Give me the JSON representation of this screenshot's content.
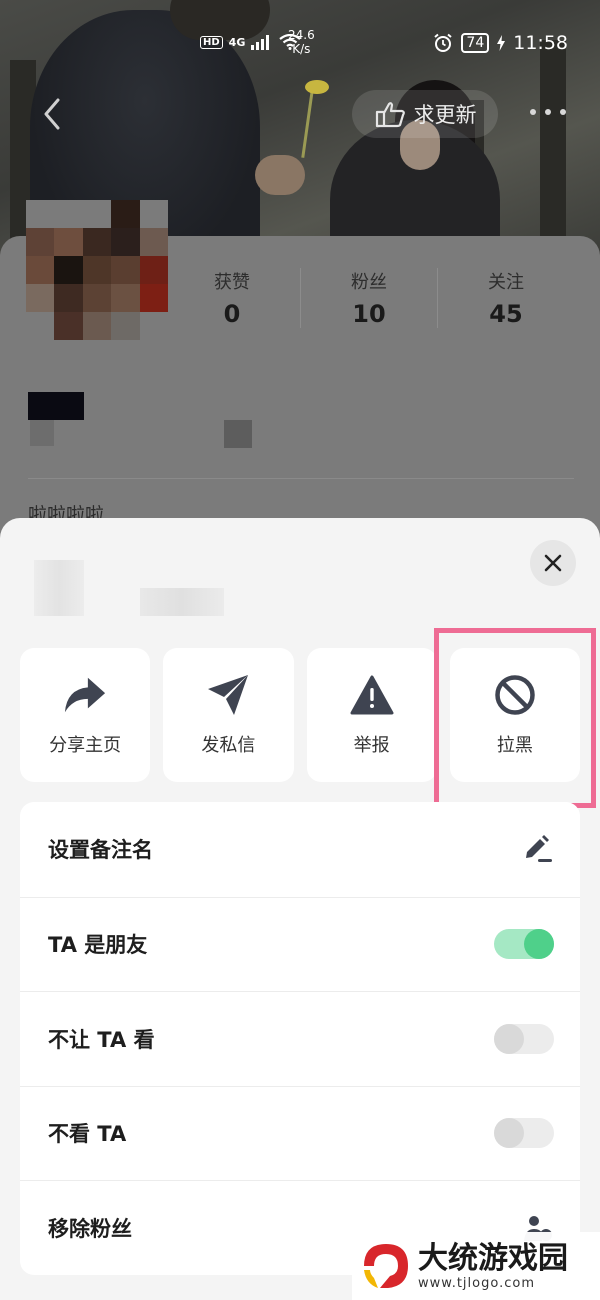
{
  "status_bar": {
    "network_badge": "HD",
    "signal_type": "4G",
    "speed_value": "24.6",
    "speed_unit": "K/s",
    "battery": "74",
    "time": "11:58"
  },
  "nav": {
    "request_update_label": "求更新"
  },
  "profile": {
    "stats": [
      {
        "label": "获赞",
        "value": "0"
      },
      {
        "label": "粉丝",
        "value": "10"
      },
      {
        "label": "关注",
        "value": "45"
      }
    ],
    "bio": "啦啦啦啦"
  },
  "sheet": {
    "actions": [
      {
        "label": "分享主页",
        "icon": "share-icon"
      },
      {
        "label": "发私信",
        "icon": "send-icon"
      },
      {
        "label": "举报",
        "icon": "warning-icon"
      },
      {
        "label": "拉黑",
        "icon": "block-icon"
      }
    ],
    "settings": [
      {
        "label": "设置备注名",
        "control": "edit"
      },
      {
        "label": "TA 是朋友",
        "control": "toggle",
        "on": true
      },
      {
        "label": "不让 TA 看",
        "control": "toggle",
        "on": false
      },
      {
        "label": "不看 TA",
        "control": "toggle",
        "on": false
      },
      {
        "label": "移除粉丝",
        "control": "remove-fan-icon"
      }
    ]
  },
  "watermark": {
    "title": "大统游戏园",
    "url": "www.tjlogo.com"
  },
  "colors": {
    "highlight": "#ee6c94",
    "toggle_on": "#4fd08a",
    "sheet_bg": "#f4f4f4"
  }
}
